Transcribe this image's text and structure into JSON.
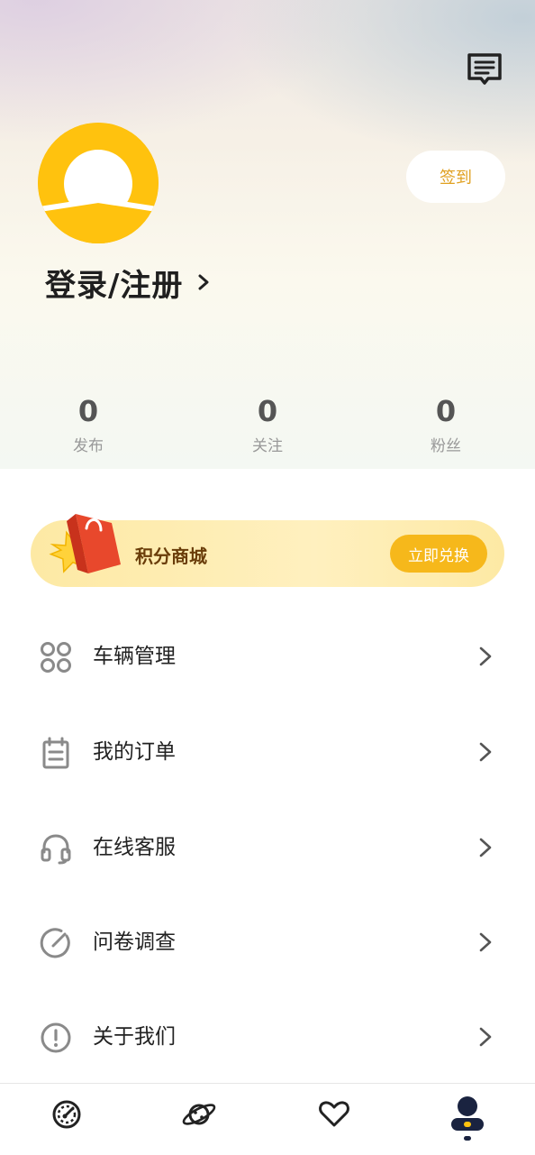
{
  "header": {
    "message_icon": "message-icon",
    "checkin_label": "签到",
    "login_label": "登录/注册",
    "stats": [
      {
        "value": "0",
        "label": "发布"
      },
      {
        "value": "0",
        "label": "关注"
      },
      {
        "value": "0",
        "label": "粉丝"
      }
    ]
  },
  "mall": {
    "title": "积分商城",
    "button_label": "立即兑换",
    "icon": "shopping-bag-icon"
  },
  "menu": [
    {
      "label": "车辆管理",
      "icon": "grid-icon"
    },
    {
      "label": "我的订单",
      "icon": "clipboard-icon"
    },
    {
      "label": "在线客服",
      "icon": "headset-icon"
    },
    {
      "label": "问卷调查",
      "icon": "survey-icon"
    },
    {
      "label": "关于我们",
      "icon": "info-icon"
    }
  ],
  "bottom_nav": [
    {
      "icon": "dashboard-icon",
      "active": false
    },
    {
      "icon": "planet-icon",
      "active": false
    },
    {
      "icon": "heart-icon",
      "active": false
    },
    {
      "icon": "profile-icon",
      "active": true
    }
  ],
  "colors": {
    "accent_yellow": "#ffc20e",
    "button_yellow": "#f6b81b",
    "checkin_text": "#e0a020",
    "icon_gray": "#888888"
  }
}
